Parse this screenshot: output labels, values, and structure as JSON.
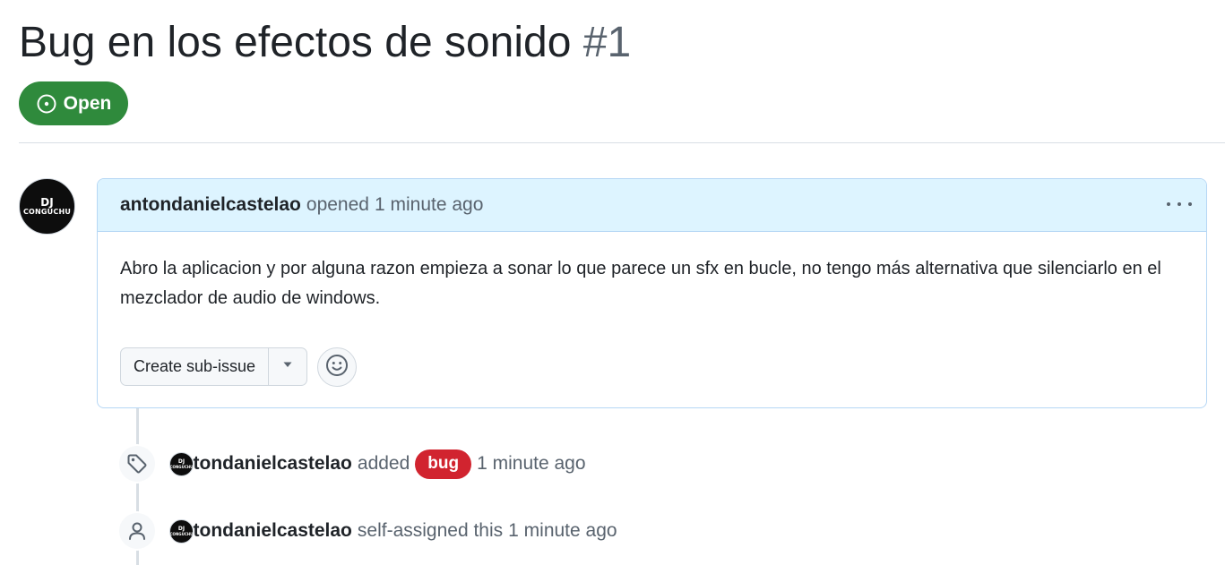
{
  "issue": {
    "title": "Bug en los efectos de sonido",
    "number": "#1",
    "state": "Open",
    "state_color": "#2f8a3c"
  },
  "comment": {
    "author": "antondanielcastelao",
    "action": "opened",
    "time": "1 minute ago",
    "body": "Abro la aplicacion y por alguna razon empieza a sonar lo que parece un sfx en bucle, no tengo más alternativa que silenciarlo en el mezclador de audio de windows.",
    "avatar_text_top": "DJ",
    "avatar_text_bottom": "CONGUCHU",
    "menu_icon": "kebab-horizontal-icon",
    "create_sub_issue_label": "Create sub-issue",
    "reaction_icon": "smiley-icon"
  },
  "timeline": [
    {
      "icon": "tag-icon",
      "actor": "antondanielcastelao",
      "action": "added",
      "label": "bug",
      "label_color": "#d1242f",
      "time": "1 minute ago"
    },
    {
      "icon": "person-icon",
      "actor": "antondanielcastelao",
      "action": "self-assigned this",
      "time": "1 minute ago"
    }
  ]
}
